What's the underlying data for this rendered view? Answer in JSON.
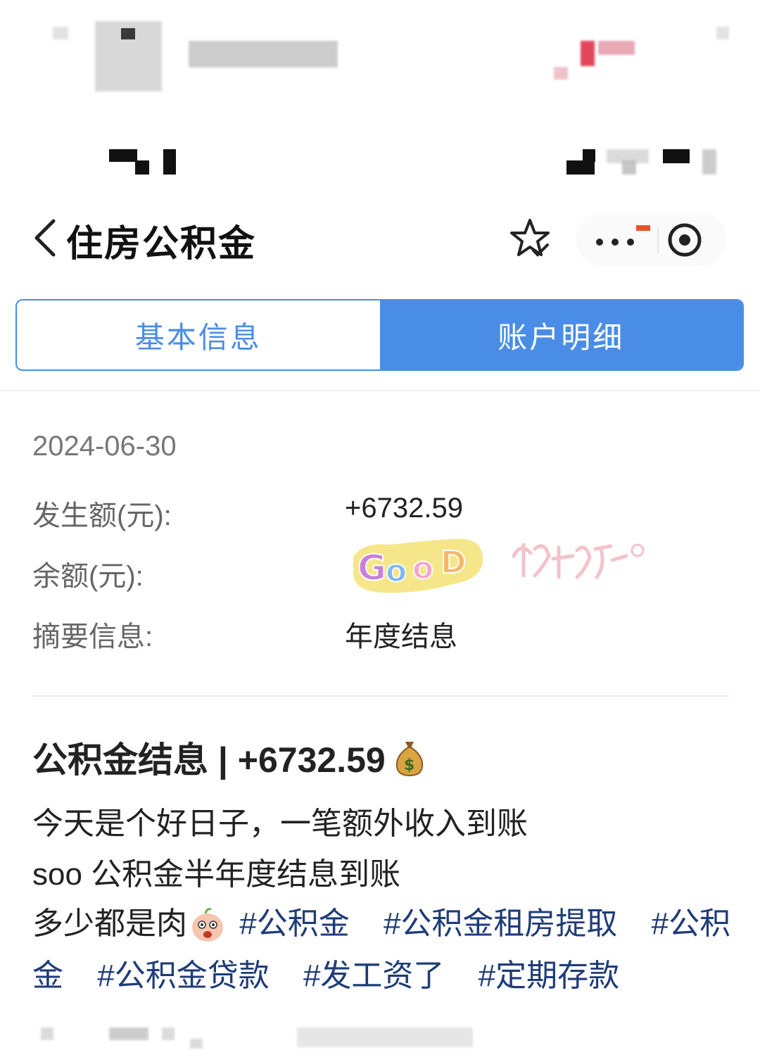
{
  "navbar": {
    "title": "住房公积金"
  },
  "tabs": [
    {
      "label": "基本信息",
      "active": false
    },
    {
      "label": "账户明细",
      "active": true
    }
  ],
  "record": {
    "date": "2024-06-30",
    "amount_label": "发生额(元):",
    "amount_value": "+6732.59",
    "balance_label": "余额(元):",
    "summary_label": "摘要信息:",
    "summary_value": "年度结息",
    "sticker_text": "GOOD",
    "watermark": "捡破烂"
  },
  "post": {
    "title": "公积金结息 | +6732.59",
    "line1": "今天是个好日子，一笔额外收入到账",
    "line2": "soo 公积金半年度结息到账",
    "line3_text": "多少都是肉",
    "tags_line3": [
      "#公积金",
      "#公积金租房提取",
      "#公积"
    ],
    "tags_line4": [
      "金",
      "#公积金贷款",
      "#发工资了",
      "#定期存款"
    ]
  },
  "colors": {
    "accent": "#4a8de6",
    "tag": "#1e3c78"
  },
  "icons": [
    "back-icon",
    "star-icon",
    "more-icon",
    "target-icon",
    "moneybag-icon",
    "pig-emoji-icon"
  ]
}
